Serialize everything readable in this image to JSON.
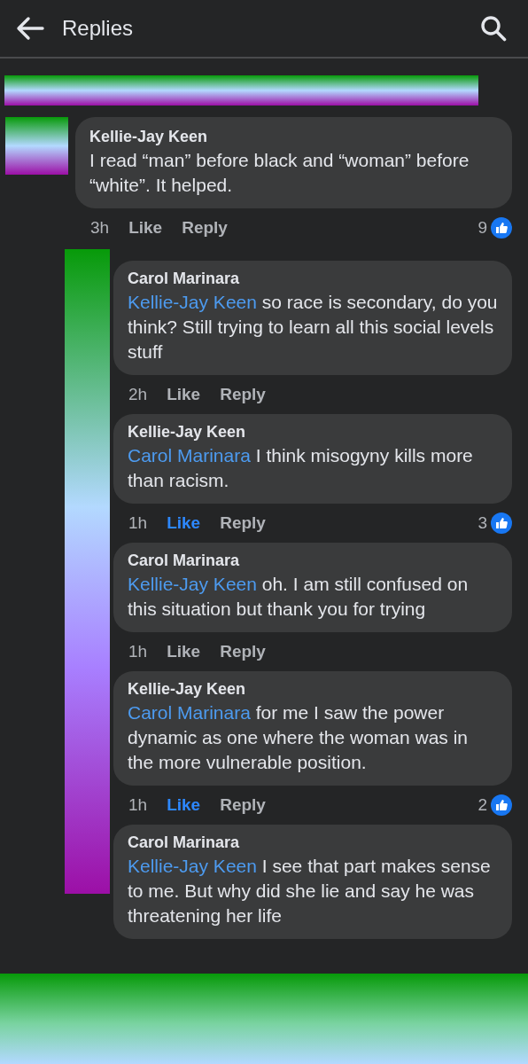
{
  "header": {
    "title": "Replies"
  },
  "comment": {
    "author": "Kellie-Jay Keen",
    "text": "I read “man” before black and “woman” before “white”.  It helped.",
    "time": "3h",
    "like": "Like",
    "liked": false,
    "reply": "Reply",
    "reactions": "9",
    "children": [
      {
        "author": "Carol Marinara",
        "mention": "Kellie-Jay Keen",
        "text": "so race is secondary, do you think? Still trying to learn all this social levels stuff",
        "time": "2h",
        "like": "Like",
        "liked": false,
        "reply": "Reply"
      },
      {
        "author": "Kellie-Jay Keen",
        "mention": "Carol Marinara",
        "text": "I think misogyny kills more than racism.",
        "time": "1h",
        "like": "Like",
        "liked": true,
        "reply": "Reply",
        "reactions": "3"
      },
      {
        "author": "Carol Marinara",
        "mention": "Kellie-Jay Keen",
        "text": "oh. I am still confused on this situation but thank you for trying",
        "time": "1h",
        "like": "Like",
        "liked": false,
        "reply": "Reply"
      },
      {
        "author": "Kellie-Jay Keen",
        "mention": "Carol Marinara",
        "text": " for me I saw the power dynamic as one where the woman was in the more vulnerable position.",
        "time": "1h",
        "like": "Like",
        "liked": true,
        "reply": "Reply",
        "reactions": "2"
      },
      {
        "author": "Carol Marinara",
        "mention": "Kellie-Jay Keen",
        "text": "I see that part makes sense to me. But why did she lie and say he was threatening her life"
      }
    ]
  }
}
